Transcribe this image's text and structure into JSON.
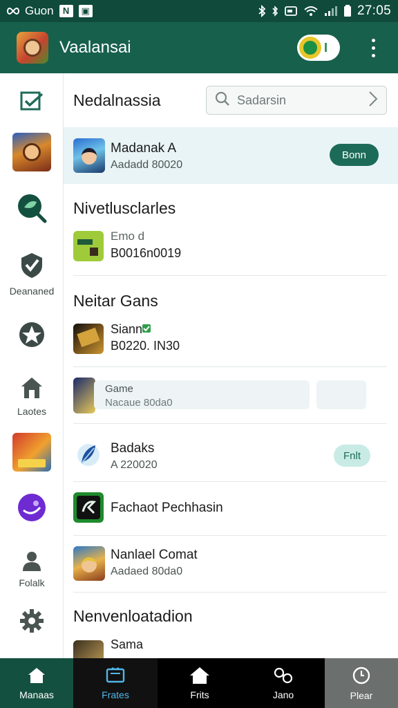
{
  "status_bar": {
    "carrier": "Guon",
    "time": "27:05"
  },
  "app_bar": {
    "title": "Vaalansai",
    "toggle_text": "I"
  },
  "sidebar": {
    "items": [
      {
        "icon": "checklist-icon",
        "label": ""
      },
      {
        "icon": "game-thumbnail-warrior",
        "label": ""
      },
      {
        "icon": "search-leaf-icon",
        "label": ""
      },
      {
        "icon": "shield-check-icon",
        "label": "Deananed"
      },
      {
        "icon": "star-badge-icon",
        "label": ""
      },
      {
        "icon": "home-icon",
        "label": "Laotes"
      },
      {
        "icon": "game-thumbnail-fighter",
        "label": ""
      },
      {
        "icon": "purple-orb-icon",
        "label": ""
      },
      {
        "icon": "person-icon",
        "label": "Folalk"
      },
      {
        "icon": "gear-icon",
        "label": ""
      }
    ]
  },
  "main": {
    "header_title": "Nedalnassia",
    "search": {
      "placeholder": "Sadarsin"
    },
    "sections": [
      {
        "title": "Nivetlusclarles"
      },
      {
        "title": "Neitar Gans"
      },
      {
        "title": "Nenvenloatadion"
      }
    ],
    "rows": [
      {
        "title": "Madanak A",
        "subtitle": "Aadadd 80020",
        "button": "Bonn"
      },
      {
        "title": "Emo d",
        "subtitle": "B0016n0019"
      },
      {
        "title": "Siann",
        "subtitle": "B0220. IN30"
      },
      {
        "title": "Game",
        "subtitle": "Nacaue 80da0"
      },
      {
        "title": "Badaks",
        "subtitle": "A 220020",
        "button": "Fnlt"
      },
      {
        "title": "Fachaot Pechhasin"
      },
      {
        "title": "Nanlael Comat",
        "subtitle": "Aadaed 80da0"
      },
      {
        "title": "Sama"
      }
    ]
  },
  "bottom_nav": {
    "items": [
      {
        "label": "Manaas",
        "icon": "home-icon"
      },
      {
        "label": "Frates",
        "icon": "tv-icon"
      },
      {
        "label": "Frits",
        "icon": "house-icon"
      },
      {
        "label": "Jano",
        "icon": "link-icon"
      },
      {
        "label": "Plear",
        "icon": "clock-icon"
      }
    ]
  },
  "colors": {
    "primary_dark": "#0f4a3b",
    "primary": "#17604c",
    "accent_button": "#1c6b58",
    "highlight_row": "#e9f4f7",
    "active_nav_text": "#52b6e8"
  }
}
